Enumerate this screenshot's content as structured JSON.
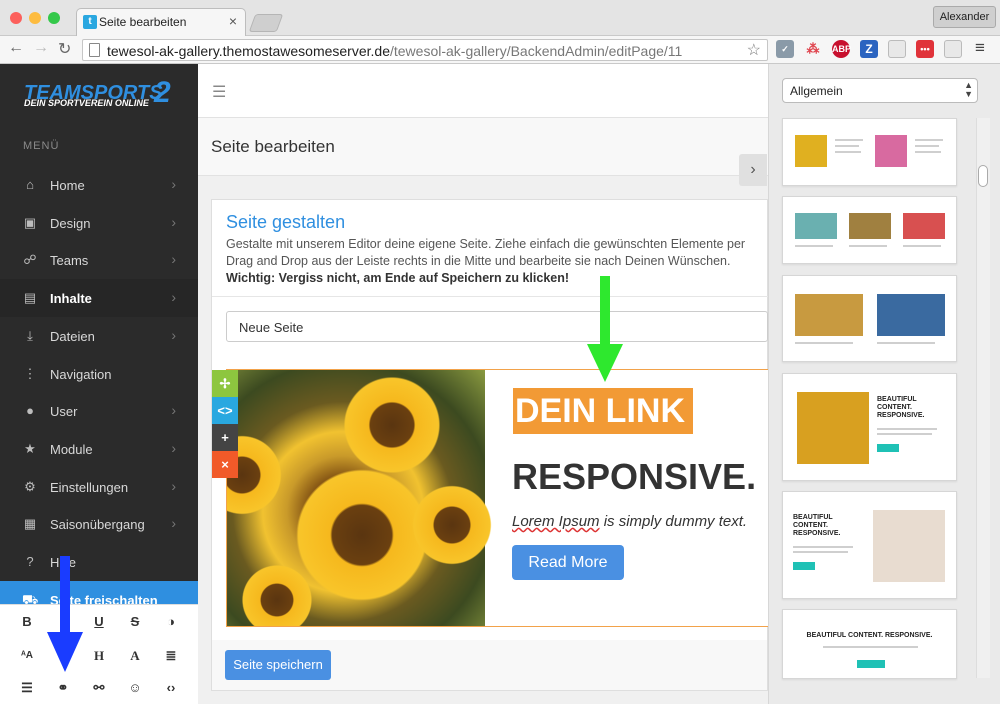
{
  "browser": {
    "tab_title": "Seite bearbeiten",
    "tab_favicon": "t",
    "tab_close": "×",
    "profile": "Alexander",
    "url_host": "tewesol-ak-gallery.themostawesomeserver.de",
    "url_path": "/tewesol-ak-gallery/BackendAdmin/editPage/11",
    "extensions": [
      "ABP",
      "Z"
    ]
  },
  "sidebar": {
    "logo_main": "TEAMSPORTS",
    "logo_number": "2",
    "logo_sub": "DEIN SPORTVEREIN ONLINE",
    "menu_heading": "MENÜ",
    "items": [
      {
        "label": "Home",
        "icon": "home-icon",
        "glyph": "⌂"
      },
      {
        "label": "Design",
        "icon": "image-icon",
        "glyph": "▣"
      },
      {
        "label": "Teams",
        "icon": "users-icon",
        "glyph": "☍"
      },
      {
        "label": "Inhalte",
        "icon": "list-icon",
        "glyph": "▤"
      },
      {
        "label": "Dateien",
        "icon": "download-icon",
        "glyph": "⤓"
      },
      {
        "label": "Navigation",
        "icon": "dots-icon",
        "glyph": "⋮"
      },
      {
        "label": "User",
        "icon": "user-icon",
        "glyph": "●"
      },
      {
        "label": "Module",
        "icon": "star-icon",
        "glyph": "★"
      },
      {
        "label": "Einstellungen",
        "icon": "gears-icon",
        "glyph": "⚙"
      },
      {
        "label": "Saisonübergang",
        "icon": "calendar-icon",
        "glyph": "▦"
      },
      {
        "label": "Hilfe",
        "icon": "question-icon",
        "glyph": "?"
      },
      {
        "label": "Seite freischalten",
        "icon": "cart-icon",
        "glyph": "⛟"
      }
    ],
    "editor_tools": [
      {
        "name": "bold-icon",
        "glyph": "B"
      },
      {
        "name": "underline-icon",
        "glyph": "U"
      },
      {
        "name": "strikethrough-icon",
        "glyph": "S"
      },
      {
        "name": "contrast-icon",
        "glyph": "◑"
      },
      {
        "name": "font-size-icon",
        "glyph": "ᴬA"
      },
      {
        "name": "heading-icon",
        "glyph": "H"
      },
      {
        "name": "font-icon",
        "glyph": "A"
      },
      {
        "name": "align-icon",
        "glyph": "≣"
      },
      {
        "name": "list-icon",
        "glyph": "☰"
      },
      {
        "name": "link-icon",
        "glyph": "⚭"
      },
      {
        "name": "unlink-icon",
        "glyph": "⚯"
      },
      {
        "name": "smiley-icon",
        "glyph": "☺"
      },
      {
        "name": "code-icon",
        "glyph": "‹›"
      }
    ]
  },
  "main": {
    "header_title": "Seite bearbeiten",
    "panel_title": "Seite gestalten",
    "panel_desc": "Gestalte mit unserem Editor deine eigene Seite. Ziehe einfach die gewünschten Elemente per Drag and Drop aus der Leiste rechts in die Mitte und bearbeite sie nach Deinen Wünschen.",
    "panel_warning": "Wichtig: Vergiss nicht, am Ende auf Speichern zu klicken!",
    "page_select": "Neue Seite",
    "block_tools": [
      {
        "name": "move-icon",
        "glyph": "✢",
        "color": "#8dc63f"
      },
      {
        "name": "code-icon",
        "glyph": "<>",
        "color": "#29a8e0"
      },
      {
        "name": "add-icon",
        "glyph": "+",
        "color": "#444444"
      },
      {
        "name": "delete-icon",
        "glyph": "×",
        "color": "#f15a29"
      }
    ],
    "block": {
      "link_text": "DEIN LINK",
      "headline": "RESPONSIVE.",
      "lorem_link": "Lorem Ipsum",
      "lorem_rest": " is simply dummy text.",
      "button": "Read More"
    },
    "save_button": "Seite speichern"
  },
  "right_panel": {
    "category": "Allgemein",
    "templates": [
      {
        "heading": ""
      },
      {
        "heading": ""
      },
      {
        "heading": ""
      },
      {
        "heading": "BEAUTIFUL CONTENT. RESPONSIVE."
      },
      {
        "heading": "BEAUTIFUL CONTENT. RESPONSIVE."
      },
      {
        "heading": "BEAUTIFUL CONTENT. RESPONSIVE."
      }
    ]
  },
  "colors": {
    "accent": "#2f8fe0",
    "sidebar_bg": "#2b2b2b",
    "link_bg": "#f29a35",
    "button": "#4a90e2",
    "arrow_green": "#2ee82e",
    "arrow_blue": "#1a3cff"
  }
}
